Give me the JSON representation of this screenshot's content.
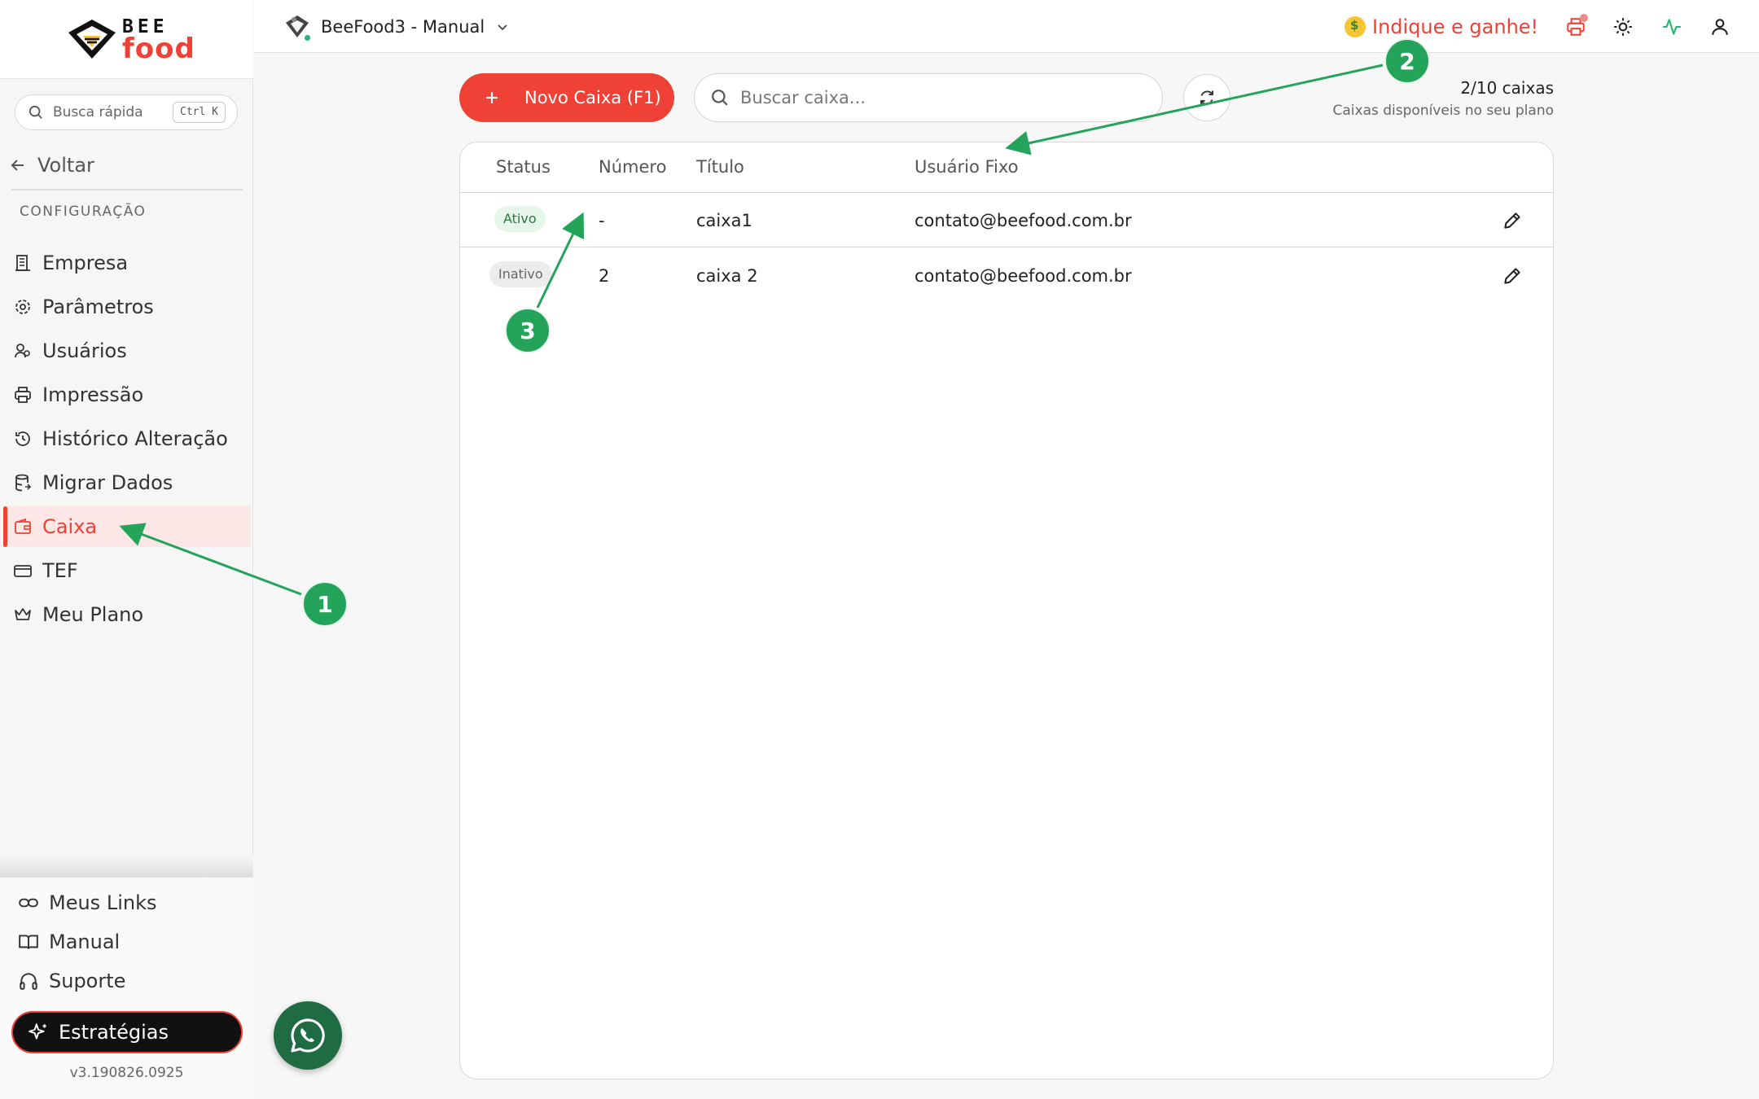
{
  "brand": {
    "line1": "BEE",
    "line2": "food"
  },
  "sidebar": {
    "quick_search_label": "Busca rápida",
    "quick_search_shortcut": "Ctrl K",
    "back_label": "Voltar",
    "section_title": "CONFIGURAÇÃO",
    "items": [
      {
        "label": "Empresa",
        "icon": "building-icon"
      },
      {
        "label": "Parâmetros",
        "icon": "gear-icon"
      },
      {
        "label": "Usuários",
        "icon": "users-icon"
      },
      {
        "label": "Impressão",
        "icon": "printer-icon"
      },
      {
        "label": "Histórico Alteração",
        "icon": "history-icon"
      },
      {
        "label": "Migrar Dados",
        "icon": "database-icon"
      },
      {
        "label": "Caixa",
        "icon": "wallet-icon",
        "active": true
      },
      {
        "label": "TEF",
        "icon": "card-icon"
      },
      {
        "label": "Meu Plano",
        "icon": "crown-icon"
      }
    ],
    "bottom": {
      "links_label": "Meus Links",
      "manual_label": "Manual",
      "support_label": "Suporte",
      "strategies_label": "Estratégias"
    },
    "version": "v3.190826.0925"
  },
  "header": {
    "company_name": "BeeFood3 - Manual",
    "refer_label": "Indique e ganhe!"
  },
  "toolbar": {
    "new_button_label": "Novo Caixa (F1)",
    "search_placeholder": "Buscar caixa...",
    "plan_count": "2/10 caixas",
    "plan_subtitle": "Caixas disponíveis no seu plano"
  },
  "table": {
    "columns": [
      "Status",
      "Número",
      "Título",
      "Usuário Fixo"
    ],
    "rows": [
      {
        "status": "Ativo",
        "numero": "-",
        "titulo": "caixa1",
        "usuario": "contato@beefood.com.br"
      },
      {
        "status": "Inativo",
        "numero": "2",
        "titulo": "caixa 2",
        "usuario": "contato@beefood.com.br"
      }
    ]
  },
  "annotations": {
    "m1": "1",
    "m2": "2",
    "m3": "3"
  },
  "colors": {
    "accent": "#ef4136",
    "annotation": "#23a45a",
    "success": "#22b573",
    "whatsapp": "#1f6b43"
  }
}
